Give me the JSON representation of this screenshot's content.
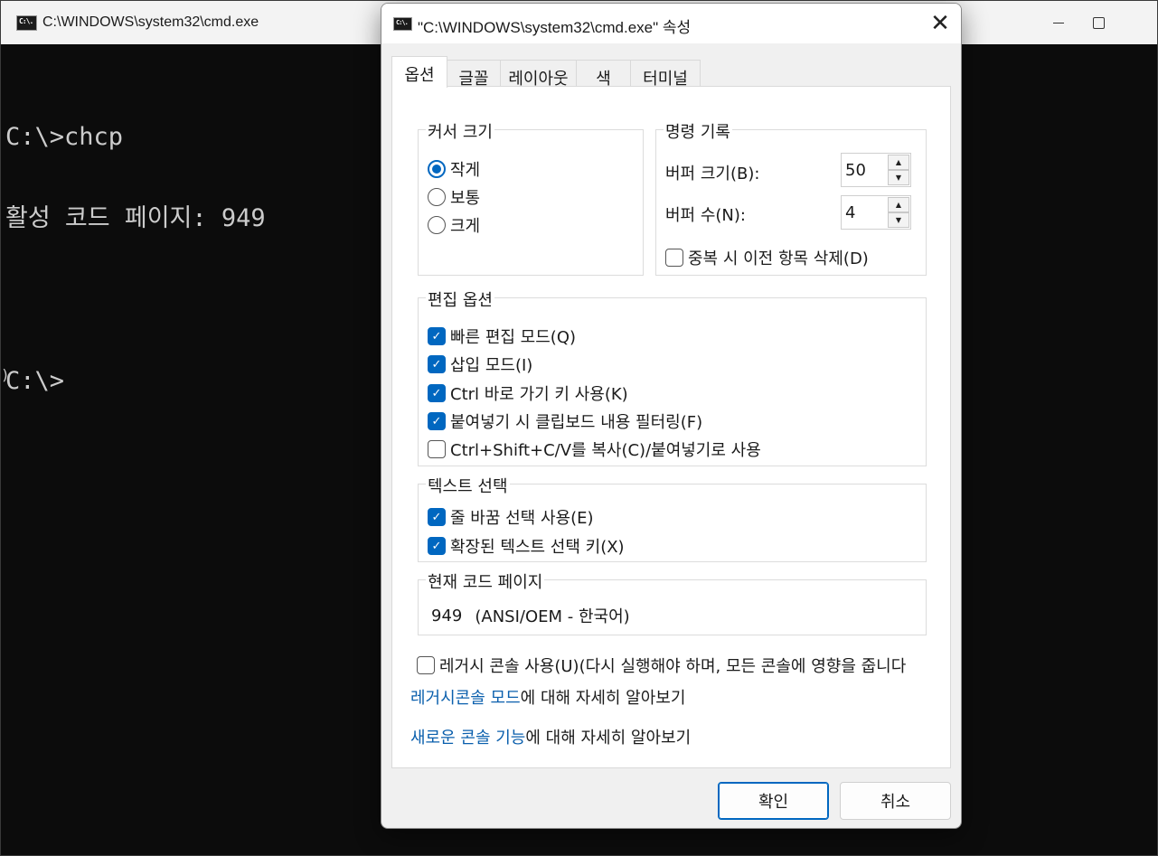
{
  "cmd_window": {
    "title": "C:\\WINDOWS\\system32\\cmd.exe",
    "icon": "cmd-icon",
    "icon_text": "C:\\.",
    "console_lines": [
      "C:\\>chcp",
      "활성 코드 페이지: 949",
      "",
      "C:\\>"
    ],
    "background": "#0c0c0c",
    "text_color": "#cccccc"
  },
  "dialog": {
    "title": "\"C:\\WINDOWS\\system32\\cmd.exe\" 속성",
    "close_glyph": "✕",
    "tabs": [
      {
        "label": "옵션",
        "active": true
      },
      {
        "label": "글꼴",
        "active": false
      },
      {
        "label": "레이아웃",
        "active": false
      },
      {
        "label": "색",
        "active": false
      },
      {
        "label": "터미널",
        "active": false
      }
    ],
    "cursor_size": {
      "title": "커서 크기",
      "options": [
        {
          "label": "작게",
          "selected": true
        },
        {
          "label": "보통",
          "selected": false
        },
        {
          "label": "크게",
          "selected": false
        }
      ]
    },
    "command_history": {
      "title": "명령 기록",
      "buffer_size_label": "버퍼 크기(B):",
      "buffer_size_value": "50",
      "buffer_count_label": "버퍼 수(N):",
      "buffer_count_value": "4",
      "discard_duplicates_label": "중복 시 이전 항목 삭제(D)",
      "discard_duplicates_checked": false
    },
    "edit_options": {
      "title": "편집 옵션",
      "items": [
        {
          "label": "빠른 편집 모드(Q)",
          "checked": true
        },
        {
          "label": "삽입 모드(I)",
          "checked": true
        },
        {
          "label": "Ctrl 바로 가기 키 사용(K)",
          "checked": true
        },
        {
          "label": "붙여넣기 시 클립보드 내용 필터링(F)",
          "checked": true
        },
        {
          "label": "Ctrl+Shift+C/V를 복사(C)/붙여넣기로 사용",
          "checked": false
        }
      ]
    },
    "text_selection": {
      "title": "텍스트 선택",
      "items": [
        {
          "label": "줄 바꿈 선택 사용(E)",
          "checked": true
        },
        {
          "label": "확장된 텍스트 선택 키(X)",
          "checked": true
        }
      ]
    },
    "code_page": {
      "title": "현재 코드 페이지",
      "number": "949",
      "description": "(ANSI/OEM - 한국어)"
    },
    "legacy": {
      "label": "레거시 콘솔 사용(U)(다시 실행해야 하며, 모든 콘솔에 영향을 줍니다",
      "checked": false
    },
    "links": {
      "legacy_link": "레거시콘솔 모드",
      "legacy_suffix": "에 대해 자세히 알아보기",
      "new_link": "새로운 콘솔 기능",
      "new_suffix": "에 대해 자세히 알아보기"
    },
    "buttons": {
      "ok": "확인",
      "cancel": "취소"
    },
    "accent_color": "#0067c0",
    "link_color": "#0a5fad"
  }
}
